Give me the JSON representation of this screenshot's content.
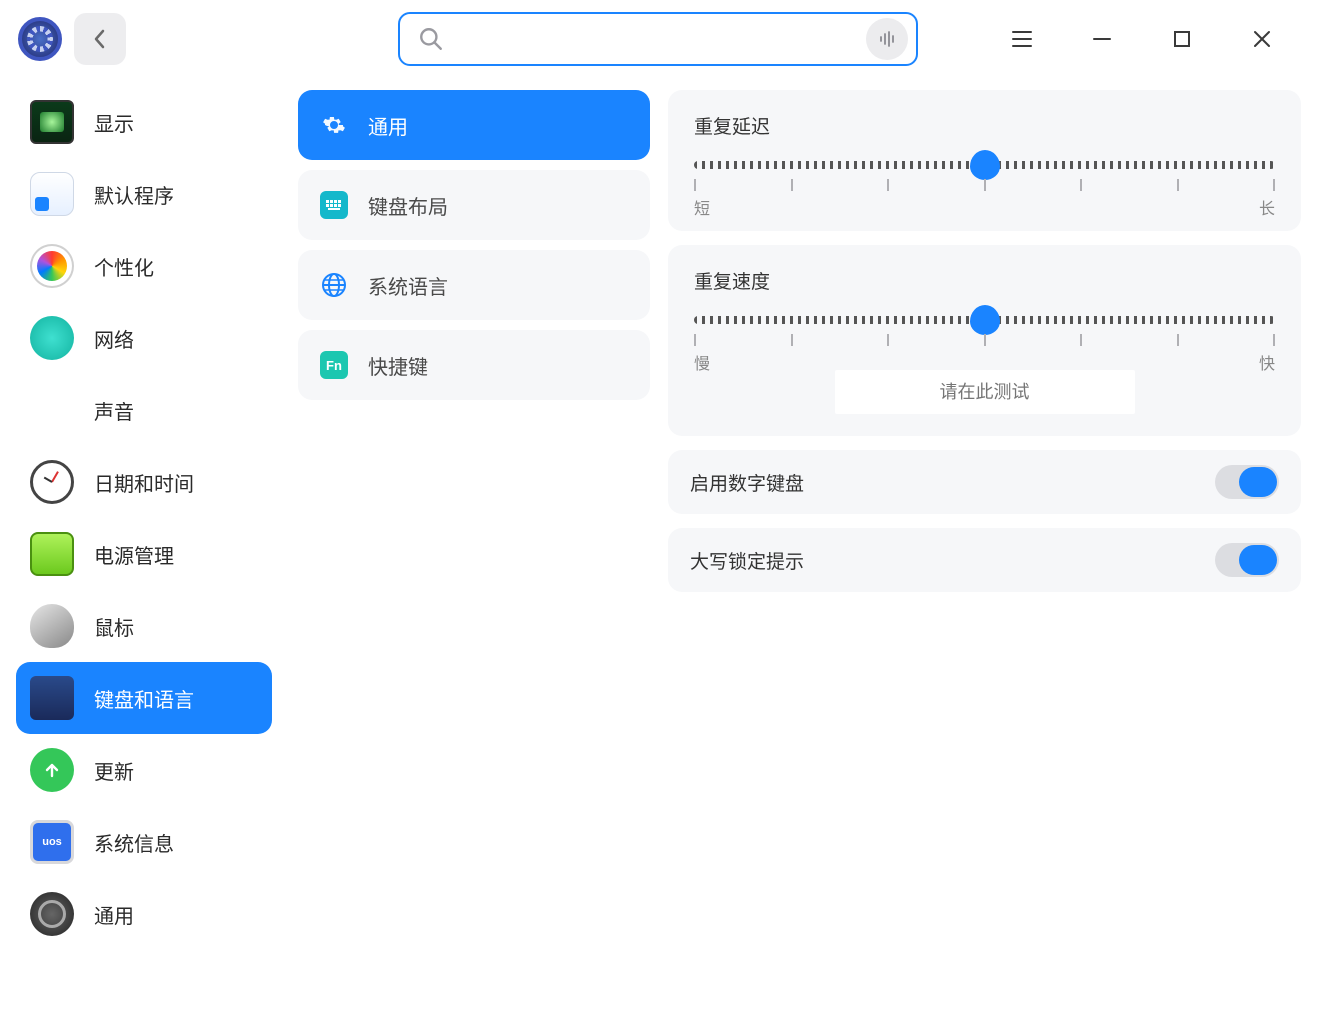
{
  "titlebar": {
    "search_placeholder": ""
  },
  "sidebar": {
    "items": [
      {
        "label": "显示",
        "icon": "display-icon",
        "active": false
      },
      {
        "label": "默认程序",
        "icon": "default-apps-icon",
        "active": false
      },
      {
        "label": "个性化",
        "icon": "personalization-icon",
        "active": false
      },
      {
        "label": "网络",
        "icon": "network-icon",
        "active": false
      },
      {
        "label": "声音",
        "icon": "sound-icon",
        "active": false
      },
      {
        "label": "日期和时间",
        "icon": "datetime-icon",
        "active": false
      },
      {
        "label": "电源管理",
        "icon": "power-icon",
        "active": false
      },
      {
        "label": "鼠标",
        "icon": "mouse-icon",
        "active": false
      },
      {
        "label": "键盘和语言",
        "icon": "keyboard-language-icon",
        "active": true
      },
      {
        "label": "更新",
        "icon": "update-icon",
        "active": false
      },
      {
        "label": "系统信息",
        "icon": "system-info-icon",
        "active": false
      },
      {
        "label": "通用",
        "icon": "general-settings-icon",
        "active": false
      }
    ]
  },
  "tabs": [
    {
      "label": "通用",
      "icon": "gear-icon",
      "active": true
    },
    {
      "label": "键盘布局",
      "icon": "keyboard-layout-icon",
      "active": false
    },
    {
      "label": "系统语言",
      "icon": "globe-icon",
      "active": false
    },
    {
      "label": "快捷键",
      "icon": "fn-icon",
      "fn_text": "Fn",
      "active": false
    }
  ],
  "settings": {
    "repeat_delay": {
      "title": "重复延迟",
      "min_label": "短",
      "max_label": "长",
      "value_percent": 50
    },
    "repeat_rate": {
      "title": "重复速度",
      "min_label": "慢",
      "max_label": "快",
      "value_percent": 50,
      "test_placeholder": "请在此测试"
    },
    "numeric_keypad": {
      "label": "启用数字键盘",
      "enabled": true
    },
    "capslock_hint": {
      "label": "大写锁定提示",
      "enabled": true
    }
  },
  "sysinfo_badge": "uos",
  "colors": {
    "accent": "#1a84ff",
    "card_bg": "#f6f7f9"
  }
}
